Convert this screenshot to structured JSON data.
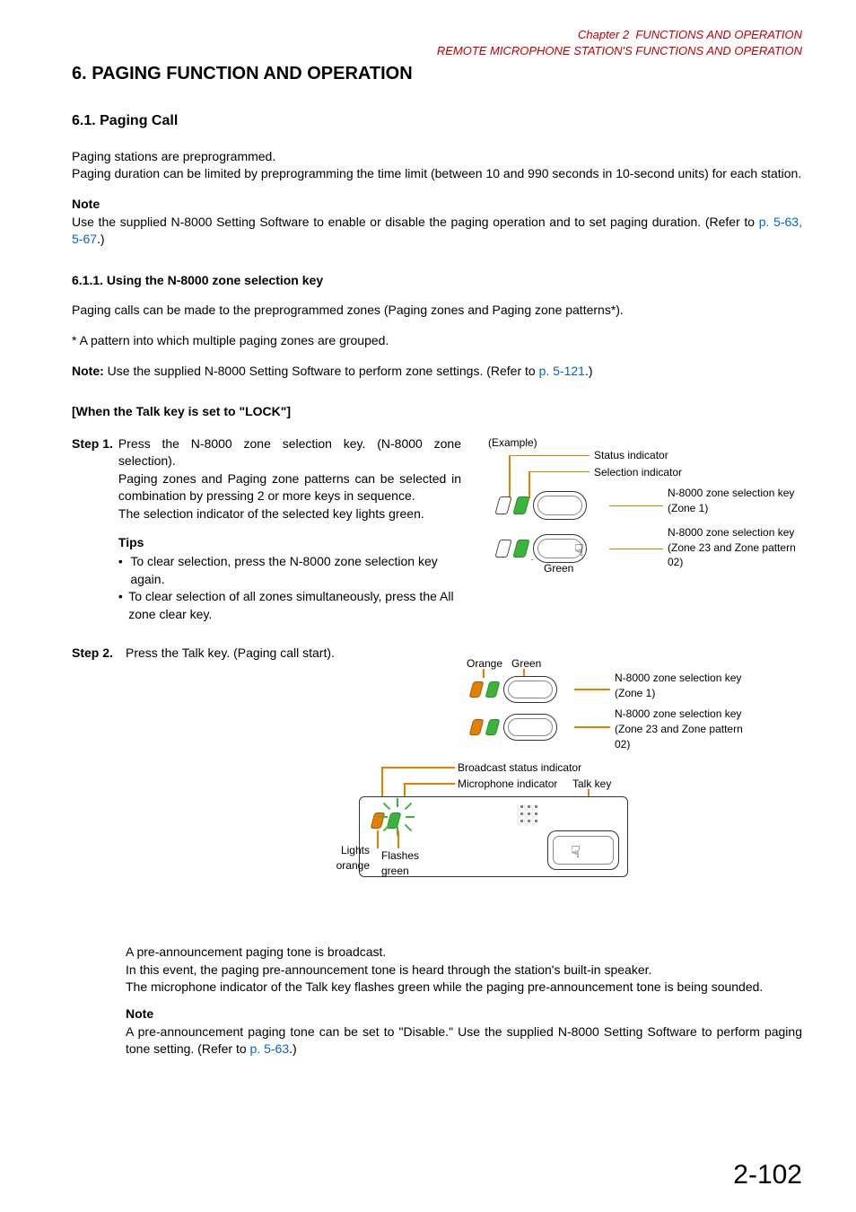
{
  "header": {
    "chapter_prefix": "Chapter 2",
    "chapter_title": "FUNCTIONS AND OPERATION",
    "section_title": "REMOTE MICROPHONE STATION'S FUNCTIONS AND OPERATION"
  },
  "h1": "6. PAGING FUNCTION AND OPERATION",
  "h2": "6.1. Paging Call",
  "intro": {
    "p1": "Paging stations are preprogrammed.",
    "p2": "Paging duration can be limited by preprogramming the time limit (between 10 and 990 seconds in 10-second units) for each station."
  },
  "note1": {
    "label": "Note",
    "text_a": "Use the supplied N-8000 Setting Software to enable or disable the paging operation and to set paging duration. (Refer to ",
    "link": "p. 5-63, 5-67",
    "text_b": ".)"
  },
  "h3": "6.1.1. Using the N-8000 zone selection key",
  "para3": "Paging calls can be made to the preprogrammed zones (Paging zones and Paging zone patterns*).",
  "footnote": "* A pattern into which multiple paging zones are grouped.",
  "note_inline": {
    "label": "Note:",
    "text_a": " Use the supplied N-8000 Setting Software to perform zone settings. (Refer to ",
    "link": "p. 5-121",
    "text_b": ".)"
  },
  "bracket": "[When the Talk key is set to \"LOCK\"]",
  "step1": {
    "label": "Step 1.",
    "line1": "Press the N-8000 zone selection key. (N-8000 zone selection).",
    "line2": "Paging zones and Paging zone patterns can be selected in combination by pressing 2 or more keys in sequence.",
    "line3": "The selection indicator of the selected key lights green.",
    "tips_label": "Tips",
    "tip1": "To clear selection, press the N-8000 zone selection key again.",
    "tip2": "To clear selection of all zones simultaneously, press the All zone clear key."
  },
  "diagram1": {
    "example": "(Example)",
    "status_indicator": "Status indicator",
    "selection_indicator": "Selection indicator",
    "zone1": "N-8000 zone selection key (Zone 1)",
    "zone2a": "N-8000 zone selection key",
    "zone2b": "(Zone 23 and  Zone pattern 02)",
    "green": "Green"
  },
  "step2": {
    "label": "Step 2.",
    "line1": "Press the Talk key. (Paging call start).",
    "after1": "A pre-announcement paging tone is broadcast.",
    "after2": "In this event, the paging pre-announcement tone is heard through the station's built-in speaker.",
    "after3": "The microphone indicator of the Talk key flashes green while the paging pre-announcement tone is being sounded.",
    "note_label": "Note",
    "note_a": "A pre-announcement paging tone can be set to \"Disable.\" Use the supplied N-8000 Setting Software to perform paging tone setting. (Refer to ",
    "note_link": "p. 5-63",
    "note_b": ".)"
  },
  "diagram2": {
    "orange": "Orange",
    "green": "Green",
    "zone1": "N-8000 zone selection key (Zone 1)",
    "zone2a": "N-8000 zone selection key",
    "zone2b": "(Zone 23 and  Zone pattern 02)",
    "broadcast": "Broadcast status indicator",
    "mic": "Microphone indicator",
    "talk": "Talk key",
    "lights_orange": "Lights orange",
    "flashes_green": "Flashes green"
  },
  "page_number": "2-102"
}
